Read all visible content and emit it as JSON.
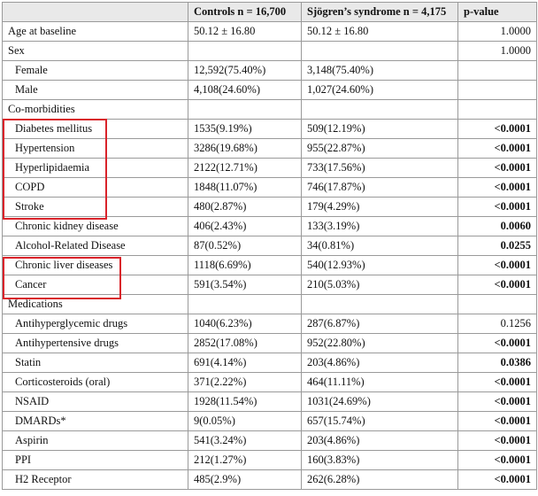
{
  "table": {
    "headers": [
      "",
      "Controls n = 16,700",
      "Sjögren’s syndrome n = 4,175",
      "p-value"
    ],
    "rows": [
      {
        "label": "Age at baseline",
        "controls": "50.12 ± 16.80",
        "sjogren": "50.12 ± 16.80",
        "p": "1.0000",
        "indent": false,
        "sig": false
      },
      {
        "label": "Sex",
        "controls": "",
        "sjogren": "",
        "p": "1.0000",
        "indent": false,
        "sig": false
      },
      {
        "label": "Female",
        "controls": "12,592(75.40%)",
        "sjogren": "3,148(75.40%)",
        "p": "",
        "indent": true,
        "sig": false
      },
      {
        "label": "Male",
        "controls": "4,108(24.60%)",
        "sjogren": "1,027(24.60%)",
        "p": "",
        "indent": true,
        "sig": false
      },
      {
        "label": "Co-morbidities",
        "controls": "",
        "sjogren": "",
        "p": "",
        "indent": false,
        "sig": false
      },
      {
        "label": "Diabetes mellitus",
        "controls": "1535(9.19%)",
        "sjogren": "509(12.19%)",
        "p": "<0.0001",
        "indent": true,
        "sig": true
      },
      {
        "label": "Hypertension",
        "controls": "3286(19.68%)",
        "sjogren": "955(22.87%)",
        "p": "<0.0001",
        "indent": true,
        "sig": true
      },
      {
        "label": "Hyperlipidaemia",
        "controls": "2122(12.71%)",
        "sjogren": "733(17.56%)",
        "p": "<0.0001",
        "indent": true,
        "sig": true
      },
      {
        "label": "COPD",
        "controls": "1848(11.07%)",
        "sjogren": "746(17.87%)",
        "p": "<0.0001",
        "indent": true,
        "sig": true
      },
      {
        "label": "Stroke",
        "controls": "480(2.87%)",
        "sjogren": "179(4.29%)",
        "p": "<0.0001",
        "indent": true,
        "sig": true
      },
      {
        "label": "Chronic kidney disease",
        "controls": "406(2.43%)",
        "sjogren": "133(3.19%)",
        "p": "0.0060",
        "indent": true,
        "sig": true
      },
      {
        "label": "Alcohol-Related Disease",
        "controls": "87(0.52%)",
        "sjogren": "34(0.81%)",
        "p": "0.0255",
        "indent": true,
        "sig": true
      },
      {
        "label": "Chronic liver diseases",
        "controls": "1118(6.69%)",
        "sjogren": "540(12.93%)",
        "p": "<0.0001",
        "indent": true,
        "sig": true
      },
      {
        "label": "Cancer",
        "controls": "591(3.54%)",
        "sjogren": "210(5.03%)",
        "p": "<0.0001",
        "indent": true,
        "sig": true
      },
      {
        "label": "Medications",
        "controls": "",
        "sjogren": "",
        "p": "",
        "indent": false,
        "sig": false
      },
      {
        "label": "Antihyperglycemic drugs",
        "controls": "1040(6.23%)",
        "sjogren": "287(6.87%)",
        "p": "0.1256",
        "indent": true,
        "sig": false
      },
      {
        "label": "Antihypertensive drugs",
        "controls": "2852(17.08%)",
        "sjogren": "952(22.80%)",
        "p": "<0.0001",
        "indent": true,
        "sig": true
      },
      {
        "label": "Statin",
        "controls": "691(4.14%)",
        "sjogren": "203(4.86%)",
        "p": "0.0386",
        "indent": true,
        "sig": true
      },
      {
        "label": "Corticosteroids (oral)",
        "controls": "371(2.22%)",
        "sjogren": "464(11.11%)",
        "p": "<0.0001",
        "indent": true,
        "sig": true
      },
      {
        "label": "NSAID",
        "controls": "1928(11.54%)",
        "sjogren": "1031(24.69%)",
        "p": "<0.0001",
        "indent": true,
        "sig": true
      },
      {
        "label": "DMARDs*",
        "controls": "9(0.05%)",
        "sjogren": "657(15.74%)",
        "p": "<0.0001",
        "indent": true,
        "sig": true
      },
      {
        "label": "Aspirin",
        "controls": "541(3.24%)",
        "sjogren": "203(4.86%)",
        "p": "<0.0001",
        "indent": true,
        "sig": true
      },
      {
        "label": "PPI",
        "controls": "212(1.27%)",
        "sjogren": "160(3.83%)",
        "p": "<0.0001",
        "indent": true,
        "sig": true
      },
      {
        "label": "H2 Receptor",
        "controls": "485(2.9%)",
        "sjogren": "262(6.28%)",
        "p": "<0.0001",
        "indent": true,
        "sig": true
      }
    ]
  },
  "highlight_color": "#d9232a"
}
